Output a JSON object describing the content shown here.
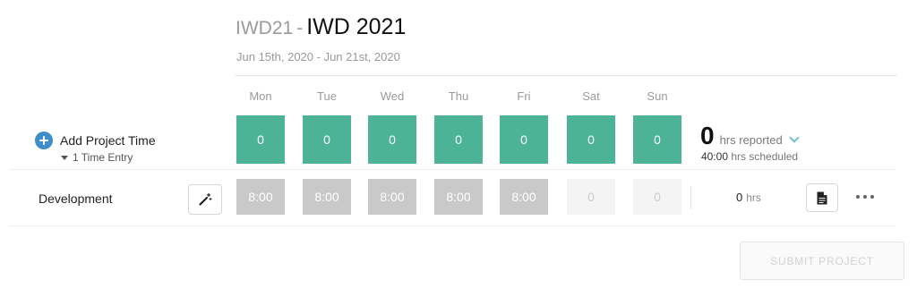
{
  "header": {
    "project_code": "IWD21",
    "separator": "-",
    "project_name": "IWD 2021",
    "date_range": "Jun 15th, 2020 - Jun 21st, 2020"
  },
  "days": [
    "Mon",
    "Tue",
    "Wed",
    "Thu",
    "Fri",
    "Sat",
    "Sun"
  ],
  "summary_row": {
    "add_label": "Add Project Time",
    "entries_label": "1 Time Entry",
    "day_totals": [
      "0",
      "0",
      "0",
      "0",
      "0",
      "0",
      "0"
    ],
    "hours_reported_value": "0",
    "hours_reported_label": "hrs reported",
    "hours_scheduled_value": "40:00",
    "hours_scheduled_label": "hrs scheduled"
  },
  "project_row": {
    "name": "Development",
    "placeholders": [
      "8:00",
      "8:00",
      "8:00",
      "8:00",
      "8:00",
      "0",
      "0"
    ],
    "total_value": "0",
    "total_unit": "hrs"
  },
  "actions": {
    "submit_label": "SUBMIT PROJECT"
  },
  "colors": {
    "day_box": "#4db396",
    "add_icon": "#3f8ec9",
    "chevron": "#6fbfd3",
    "filled_cell": "#c9c9c9",
    "empty_cell": "#f4f4f4"
  },
  "icons": {
    "add": "plus-circle-icon",
    "entries": "caret-down-icon",
    "expand": "chevron-down-icon",
    "wand": "magic-wand-icon",
    "note": "document-icon",
    "more": "more-horizontal-icon"
  }
}
